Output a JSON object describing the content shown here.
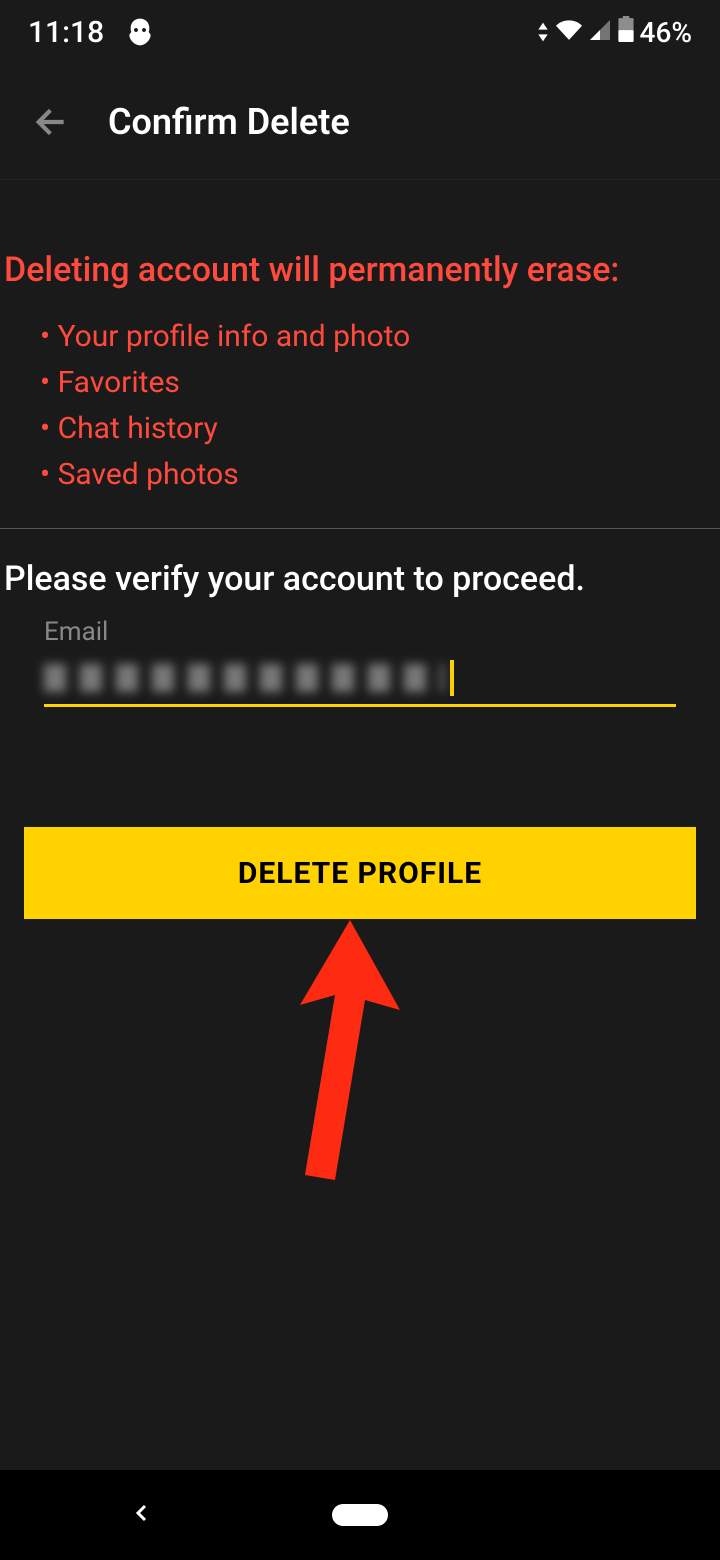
{
  "status": {
    "time": "11:18",
    "battery": "46%"
  },
  "header": {
    "title": "Confirm Delete"
  },
  "warning": {
    "heading": "Deleting account will permanently erase:",
    "items": [
      "Your profile info and photo",
      "Favorites",
      "Chat history",
      "Saved photos"
    ]
  },
  "verify": {
    "prompt": "Please verify your account to proceed.",
    "email_label": "Email",
    "email_value": ""
  },
  "actions": {
    "delete_label": "DELETE PROFILE"
  }
}
